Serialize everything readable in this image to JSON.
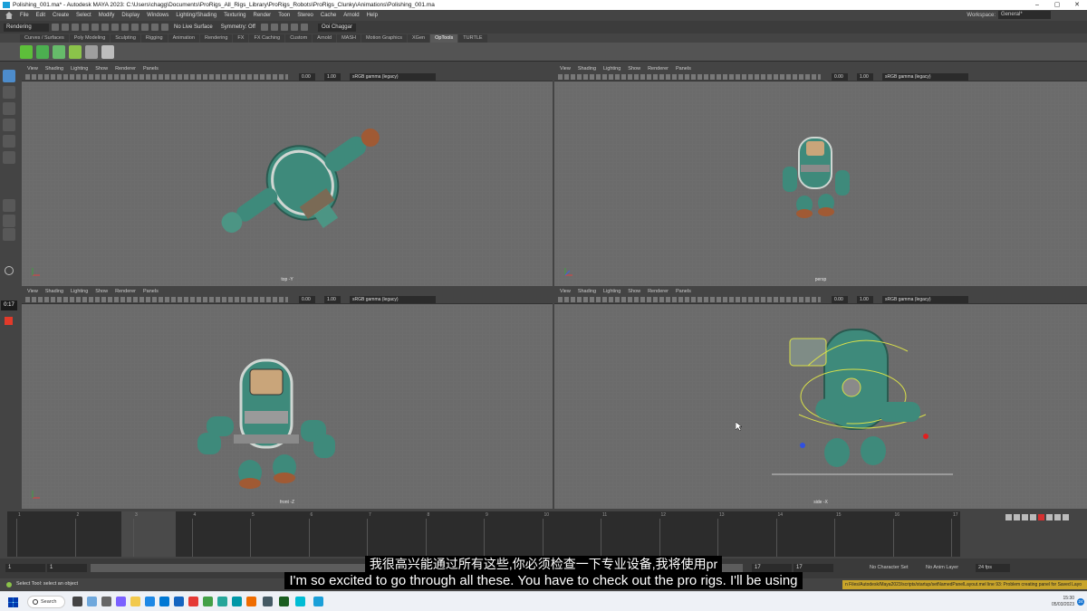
{
  "window": {
    "title": "Polishing_001.ma* - Autodesk MAYA 2023: C:\\Users\\chagg\\Documents\\ProRigs_All_Rigs_Library\\ProRigs_Robots\\ProRigs_Clunky\\Animations\\Polishing_001.ma",
    "controls": [
      "–",
      "▢",
      "✕"
    ]
  },
  "menubar": {
    "items": [
      "File",
      "Edit",
      "Create",
      "Select",
      "Modify",
      "Display",
      "Windows",
      "Lighting/Shading",
      "Texturing",
      "Render",
      "Toon",
      "Stereo",
      "Cache",
      "Arnold",
      "Help"
    ],
    "workspace_label": "Workspace:",
    "workspace_value": "General*"
  },
  "statusline": {
    "mode": "Rendering",
    "live_surface": "No Live Surface",
    "symmetry": "Symmetry: Off",
    "user": "Ooi Chaggar"
  },
  "shelf_tabs": [
    "Curves / Surfaces",
    "Poly Modeling",
    "Sculpting",
    "Rigging",
    "Animation",
    "Rendering",
    "FX",
    "FX Caching",
    "Custom",
    "Arnold",
    "MASH",
    "Motion Graphics",
    "XGen",
    "OpTools",
    "TURTLE"
  ],
  "shelf_active": "OpTools",
  "toolbox": {
    "timer": "0:17"
  },
  "viewports": [
    {
      "menu": [
        "View",
        "Shading",
        "Lighting",
        "Show",
        "Renderer",
        "Panels"
      ],
      "num1": "0.00",
      "num2": "1.00",
      "colorspace": "sRGB gamma (legacy)",
      "label": "top -Y"
    },
    {
      "menu": [
        "View",
        "Shading",
        "Lighting",
        "Show",
        "Renderer",
        "Panels"
      ],
      "num1": "0.00",
      "num2": "1.00",
      "colorspace": "sRGB gamma (legacy)",
      "label": "persp"
    },
    {
      "menu": [
        "View",
        "Shading",
        "Lighting",
        "Show",
        "Renderer",
        "Panels"
      ],
      "num1": "0.00",
      "num2": "1.00",
      "colorspace": "sRGB gamma (legacy)",
      "label": "front -Z"
    },
    {
      "menu": [
        "View",
        "Shading",
        "Lighting",
        "Show",
        "Renderer",
        "Panels"
      ],
      "num1": "0.00",
      "num2": "1.00",
      "colorspace": "sRGB gamma (legacy)",
      "label": "side -X"
    }
  ],
  "timeline": {
    "ticks": [
      "1",
      "2",
      "3",
      "4",
      "5",
      "6",
      "7",
      "8",
      "9",
      "10",
      "11",
      "12",
      "13",
      "14",
      "15",
      "16",
      "17"
    ],
    "start": "1",
    "start_inner": "1",
    "end_inner": "17",
    "end": "17",
    "character_set": "No Character Set",
    "anim_layer": "No Anim Layer",
    "fps": "24 fps"
  },
  "helpline": {
    "text": "Select Tool: select an object",
    "error": "n Files/Autodesk/Maya2023/scripts/startup/setNamedPanelLayout.mel line 93: Problem creating panel for Saved Layo"
  },
  "subtitles": {
    "cn": "我很高兴能通过所有这些,你必须检查一下专业设备,我将使用pr",
    "en": "I'm so excited to go through all these. You have to check out the pro rigs. I'll be using"
  },
  "taskbar": {
    "search": "Search",
    "time": "15:30",
    "date": "05/03/2023",
    "notifications": "24"
  },
  "colors": {
    "accent": "#4d8ccb",
    "robot": "#3f8f7f",
    "viewport": "#6b6b6b"
  }
}
